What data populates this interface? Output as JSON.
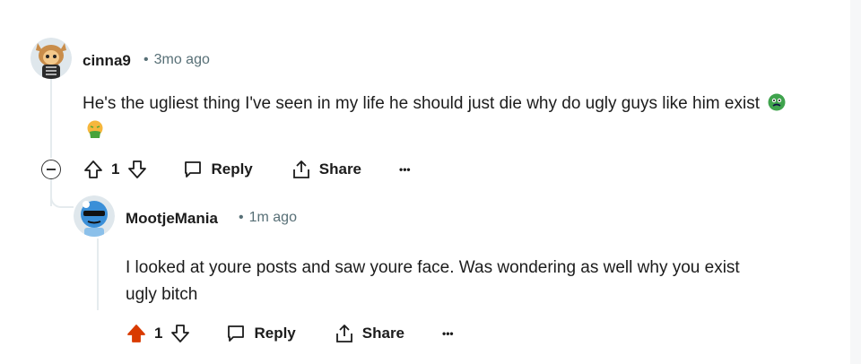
{
  "colors": {
    "upvote_active": "#d93a00",
    "meta_gray": "#576f76",
    "thread_line": "#e5ebee"
  },
  "comments": [
    {
      "author": "cinna9",
      "time": "3mo ago",
      "dot": "•",
      "text": "He's the ugliest thing I've seen in my life he should just die why do ugly guys like him exist",
      "emojis": [
        "nauseated-face-emoji",
        "vomiting-face-emoji"
      ],
      "votes": "1",
      "reply_label": "Reply",
      "share_label": "Share",
      "more_label": "•••",
      "upvoted": false
    },
    {
      "author": "MootjeMania",
      "time": "1m ago",
      "dot": "•",
      "text_line1": "I looked at youre posts and saw youre face. Was wondering as well why you exist",
      "text_line2": "ugly bitch",
      "votes": "1",
      "reply_label": "Reply",
      "share_label": "Share",
      "more_label": "•••",
      "upvoted": true
    }
  ]
}
